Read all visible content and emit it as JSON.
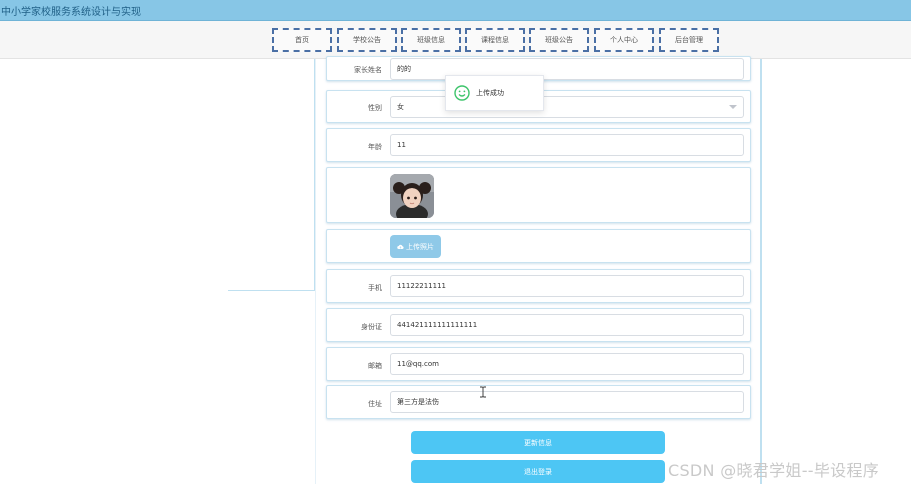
{
  "app": {
    "title": "中小学家校服务系统设计与实现"
  },
  "nav": {
    "items": [
      {
        "label": "首页"
      },
      {
        "label": "学校公告"
      },
      {
        "label": "班级信息"
      },
      {
        "label": "课程信息"
      },
      {
        "label": "班级公告"
      },
      {
        "label": "个人中心"
      },
      {
        "label": "后台管理"
      }
    ]
  },
  "form": {
    "parent_name": {
      "label": "家长姓名",
      "value": "的的"
    },
    "gender": {
      "label": "性别",
      "value": "女"
    },
    "age": {
      "label": "年龄",
      "value": "11"
    },
    "photo": {
      "upload_label": "上传照片"
    },
    "phone": {
      "label": "手机",
      "value": "11122211111"
    },
    "id_card": {
      "label": "身份证",
      "value": "441421111111111111"
    },
    "email": {
      "label": "邮箱",
      "value": "11@qq.com"
    },
    "address": {
      "label": "住址",
      "value": "第三方是法伤"
    }
  },
  "actions": {
    "update_label": "更新信息",
    "logout_label": "退出登录"
  },
  "toast": {
    "message": "上传成功",
    "icon": "smile-icon"
  },
  "watermark": {
    "text": "CSDN @晓君学姐--毕设程序"
  },
  "colors": {
    "topbar": "#87c6e6",
    "primary_button": "#4dc6f4",
    "upload_button": "#8fc9e8",
    "nav_border": "#4a6fa5"
  }
}
